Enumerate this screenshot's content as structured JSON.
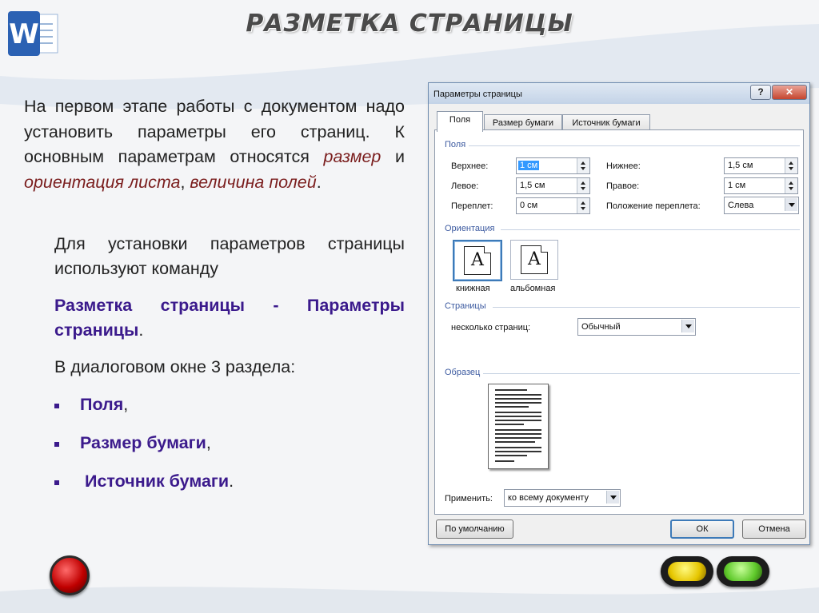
{
  "slide": {
    "title": "РАЗМЕТКА СТРАНИЦЫ",
    "para1": {
      "intro": "На первом этапе работы с документом надо установить параметры его страниц. К основным параметрам относятся ",
      "em1": "размер",
      "and": " и ",
      "em2": "ориентация листа",
      "comma": ", ",
      "em3": "величина полей",
      "end": "."
    },
    "para2": "Для установки параметров страницы используют команду",
    "para3": {
      "command": "Разметка страницы - Параметры страницы",
      "tail": "."
    },
    "para4": "В диалоговом окне 3 раздела:",
    "bullets": [
      {
        "text": "Поля",
        "punct": ","
      },
      {
        "text": "Размер бумаги",
        "punct": ","
      },
      {
        "text": "Источник бумаги",
        "punct": "."
      }
    ]
  },
  "dialog": {
    "title": "Параметры страницы",
    "help_glyph": "?",
    "close_glyph": "✕",
    "tabs": [
      "Поля",
      "Размер бумаги",
      "Источник бумаги"
    ],
    "margins": {
      "group": "Поля",
      "top_label": "Верхнее:",
      "top_value": "1 см",
      "bottom_label": "Нижнее:",
      "bottom_value": "1,5 см",
      "left_label": "Левое:",
      "left_value": "1,5 см",
      "right_label": "Правое:",
      "right_value": "1 см",
      "gutter_label": "Переплет:",
      "gutter_value": "0 см",
      "gutter_pos_label": "Положение переплета:",
      "gutter_pos_value": "Слева"
    },
    "orientation": {
      "group": "Ориентация",
      "glyph": "A",
      "portrait": "книжная",
      "landscape": "альбомная",
      "selected": "portrait"
    },
    "pages": {
      "group": "Страницы",
      "multiple_label": "несколько страниц:",
      "multiple_value": "Обычный"
    },
    "preview": {
      "group": "Образец"
    },
    "apply": {
      "label": "Применить:",
      "value": "ко всему документу"
    },
    "buttons": {
      "default": "По умолчанию",
      "ok": "ОК",
      "cancel": "Отмена"
    }
  },
  "colors": {
    "accent_text": "#3b1a8c",
    "emphasis": "#7a1d1d",
    "dialog_group": "#3c5aa0"
  }
}
